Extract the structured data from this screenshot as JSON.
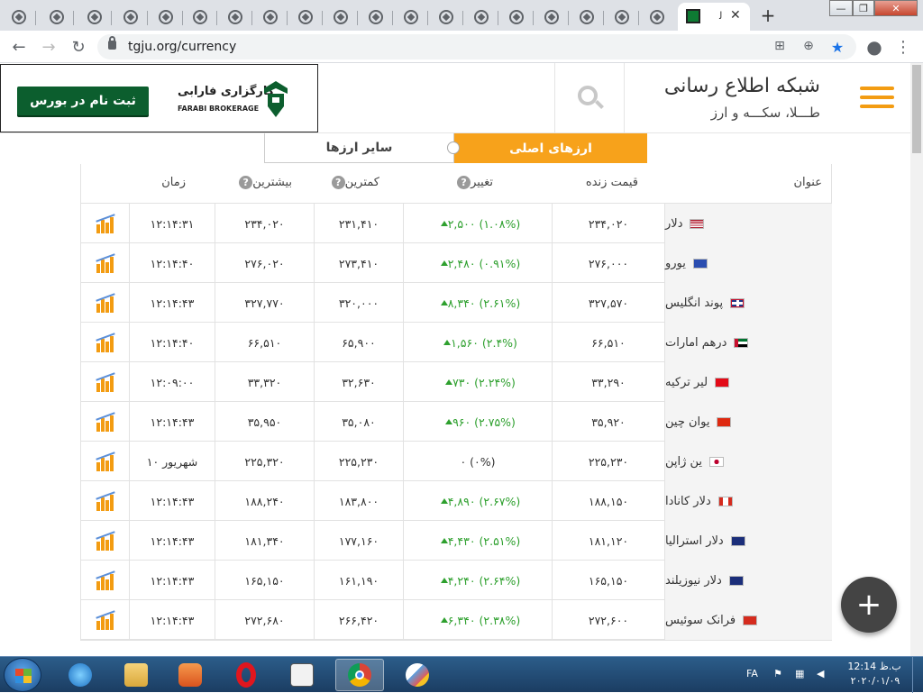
{
  "browser": {
    "active_tab_title": "ﻟ",
    "close_glyph": "✕",
    "new_tab_glyph": "+",
    "url": "tgju.org/currency",
    "window_controls": [
      "—",
      "❐",
      "✕"
    ]
  },
  "header": {
    "site_title": "شبکه اطلاع رسانی",
    "site_subtitle": "طـــلا، سکـــه و ارز"
  },
  "ad": {
    "button_label": "ثبت نام در بورس",
    "logo_text": "کارگزاری فارابی",
    "logo_text_en": "FARABI BROKERAGE"
  },
  "tabs": {
    "main": "ارزهای اصلی",
    "other": "سایر ارزها"
  },
  "table": {
    "headers": {
      "name": "عنوان",
      "price": "قیمت زنده",
      "change": "تغییر",
      "low": "کمترین",
      "high": "بیشترین",
      "time": "زمان",
      "help_glyph": "?"
    },
    "rows": [
      {
        "name": "دلار",
        "flag": "us",
        "price": "۲۳۴,۰۲۰",
        "change": "۲,۵۰۰ (۱.۰۸%)",
        "up": true,
        "low": "۲۳۱,۴۱۰",
        "high": "۲۳۴,۰۲۰",
        "time": "۱۲:۱۴:۳۱"
      },
      {
        "name": "یورو",
        "flag": "eu",
        "price": "۲۷۶,۰۰۰",
        "change": "۲,۴۸۰ (۰.۹۱%)",
        "up": true,
        "low": "۲۷۳,۴۱۰",
        "high": "۲۷۶,۰۲۰",
        "time": "۱۲:۱۴:۴۰"
      },
      {
        "name": "پوند انگلیس",
        "flag": "gb",
        "price": "۳۲۷,۵۷۰",
        "change": "۸,۳۴۰ (۲.۶۱%)",
        "up": true,
        "low": "۳۲۰,۰۰۰",
        "high": "۳۲۷,۷۷۰",
        "time": "۱۲:۱۴:۴۳"
      },
      {
        "name": "درهم امارات",
        "flag": "ae",
        "price": "۶۶,۵۱۰",
        "change": "۱,۵۶۰ (۲.۴%)",
        "up": true,
        "low": "۶۵,۹۰۰",
        "high": "۶۶,۵۱۰",
        "time": "۱۲:۱۴:۴۰"
      },
      {
        "name": "لیر ترکیه",
        "flag": "tr",
        "price": "۳۳,۲۹۰",
        "change": "۷۳۰ (۲.۲۴%)",
        "up": true,
        "low": "۳۲,۶۳۰",
        "high": "۳۳,۳۲۰",
        "time": "۱۲:۰۹:۰۰"
      },
      {
        "name": "یوان چین",
        "flag": "cn",
        "price": "۳۵,۹۲۰",
        "change": "۹۶۰ (۲.۷۵%)",
        "up": true,
        "low": "۳۵,۰۸۰",
        "high": "۳۵,۹۵۰",
        "time": "۱۲:۱۴:۴۳"
      },
      {
        "name": "ین ژاپن",
        "flag": "jp",
        "price": "۲۲۵,۲۳۰",
        "change": "۰ (۰%)",
        "up": false,
        "low": "۲۲۵,۲۳۰",
        "high": "۲۲۵,۳۲۰",
        "time": "۱۰ شهریور"
      },
      {
        "name": "دلار کانادا",
        "flag": "ca",
        "price": "۱۸۸,۱۵۰",
        "change": "۴,۸۹۰ (۲.۶۷%)",
        "up": true,
        "low": "۱۸۳,۸۰۰",
        "high": "۱۸۸,۲۴۰",
        "time": "۱۲:۱۴:۴۳"
      },
      {
        "name": "دلار استرالیا",
        "flag": "au",
        "price": "۱۸۱,۱۲۰",
        "change": "۴,۴۳۰ (۲.۵۱%)",
        "up": true,
        "low": "۱۷۷,۱۶۰",
        "high": "۱۸۱,۳۴۰",
        "time": "۱۲:۱۴:۴۳"
      },
      {
        "name": "دلار نیوزیلند",
        "flag": "nz",
        "price": "۱۶۵,۱۵۰",
        "change": "۴,۲۴۰ (۲.۶۴%)",
        "up": true,
        "low": "۱۶۱,۱۹۰",
        "high": "۱۶۵,۱۵۰",
        "time": "۱۲:۱۴:۴۳"
      },
      {
        "name": "فرانک سوئیس",
        "flag": "ch",
        "price": "۲۷۲,۶۰۰",
        "change": "۶,۳۴۰ (۲.۳۸%)",
        "up": true,
        "low": "۲۶۶,۴۲۰",
        "high": "۲۷۲,۶۸۰",
        "time": "۱۲:۱۴:۴۳"
      }
    ]
  },
  "fab_label": "+",
  "taskbar": {
    "lang": "FA",
    "time": "ب.ظ 12:14",
    "date": "۲۰۲۰/۰۱/۰۹"
  },
  "colors": {
    "accent": "#f7a21b",
    "positive": "#2ea02e",
    "ad_green": "#0c5e2e"
  }
}
